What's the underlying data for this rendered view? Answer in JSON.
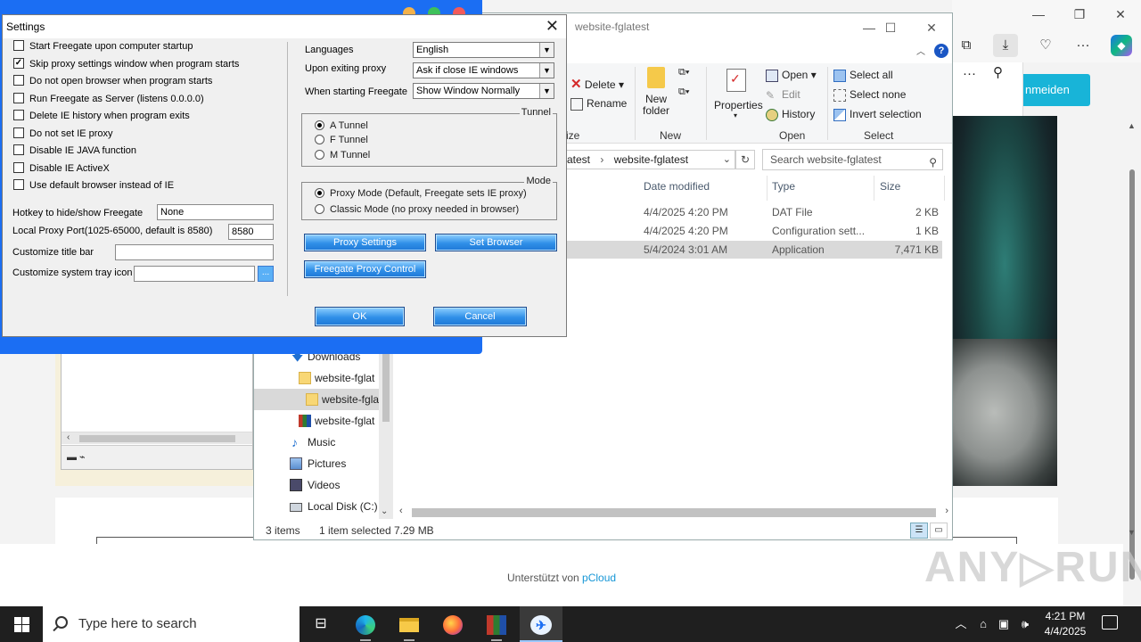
{
  "browser": {
    "teal_button": "nmeiden",
    "footer_text": "Unterstützt von ",
    "footer_link": "pCloud",
    "watermark": "ANY▷RUN"
  },
  "explorer": {
    "title": "website-fglatest",
    "ribbon": {
      "delete": "Delete",
      "rename": "Rename",
      "new_folder_line1": "New",
      "new_folder_line2": "folder",
      "properties": "Properties",
      "open": "Open",
      "edit": "Edit",
      "history": "History",
      "select_all": "Select all",
      "select_none": "Select none",
      "invert_selection": "Invert selection",
      "group_organize": "ize",
      "group_new": "New",
      "group_open": "Open",
      "group_select": "Select"
    },
    "address": {
      "part1": "atest",
      "part2": "website-fglatest"
    },
    "search_placeholder": "Search website-fglatest",
    "columns": {
      "date": "Date modified",
      "type": "Type",
      "size": "Size"
    },
    "files": [
      {
        "date": "4/4/2025 4:20 PM",
        "type": "DAT File",
        "size": "2 KB"
      },
      {
        "date": "4/4/2025 4:20 PM",
        "type": "Configuration sett...",
        "size": "1 KB"
      },
      {
        "date": "5/4/2024 3:01 AM",
        "type": "Application",
        "size": "7,471 KB"
      }
    ],
    "nav": [
      {
        "label": "Downloads"
      },
      {
        "label": "website-fglat"
      },
      {
        "label": "website-fgla"
      },
      {
        "label": "website-fglat"
      },
      {
        "label": "Music"
      },
      {
        "label": "Pictures"
      },
      {
        "label": "Videos"
      },
      {
        "label": "Local Disk (C:)"
      }
    ],
    "status": {
      "items": "3 items",
      "selected": "1 item selected",
      "size": "7.29 MB"
    }
  },
  "settings": {
    "title": "Settings",
    "checkboxes": [
      {
        "label": "Start Freegate upon computer startup",
        "checked": false
      },
      {
        "label": "Skip proxy settings window when program starts",
        "checked": true
      },
      {
        "label": "Do not open browser when program starts",
        "checked": false
      },
      {
        "label": "Run Freegate as Server (listens 0.0.0.0)",
        "checked": false
      },
      {
        "label": "Delete IE history when program exits",
        "checked": false
      },
      {
        "label": "Do not set IE proxy",
        "checked": false
      },
      {
        "label": "Disable IE JAVA function",
        "checked": false
      },
      {
        "label": "Disable IE ActiveX",
        "checked": false
      },
      {
        "label": "Use default browser instead of IE",
        "checked": false
      }
    ],
    "hotkey_label": "Hotkey to hide/show Freegate",
    "hotkey_value": "None",
    "port_label": "Local Proxy Port(1025-65000, default is 8580)",
    "port_value": "8580",
    "titlebar_label": "Customize title bar",
    "titlebar_value": "",
    "tray_label": "Customize system tray icon",
    "tray_value": "",
    "tray_browse": "...",
    "languages_label": "Languages",
    "languages_value": "English",
    "exit_label": "Upon exiting proxy",
    "exit_value": "Ask if close IE windows",
    "start_label": "When starting Freegate",
    "start_value": "Show Window Normally",
    "tunnel": {
      "title": "Tunnel",
      "options": [
        "A Tunnel",
        "F Tunnel",
        "M Tunnel"
      ],
      "selected": 0
    },
    "mode": {
      "title": "Mode",
      "options": [
        "Proxy Mode (Default, Freegate sets IE proxy)",
        "Classic Mode (no proxy needed in browser)"
      ],
      "selected": 0
    },
    "buttons": {
      "proxy_settings": "Proxy Settings",
      "set_browser": "Set Browser",
      "proxy_control": "Freegate Proxy Control",
      "ok": "OK",
      "cancel": "Cancel"
    }
  },
  "taskbar": {
    "search_placeholder": "Type here to search",
    "time": "4:21 PM",
    "date": "4/4/2025"
  },
  "colors": {
    "accent_blue": "#1b6ef3",
    "teal": "#18b4d8",
    "pcloud_link": "#1596d6"
  }
}
